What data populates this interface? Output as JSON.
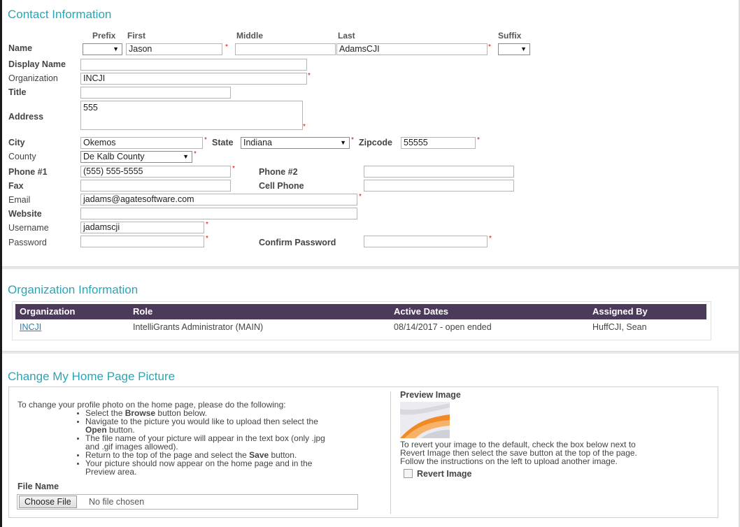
{
  "contact": {
    "title": "Contact Information",
    "col_headers": {
      "prefix": "Prefix",
      "first": "First",
      "middle": "Middle",
      "last": "Last",
      "suffix": "Suffix"
    },
    "labels": {
      "name": "Name",
      "display_name": "Display Name",
      "organization": "Organization",
      "title": "Title",
      "address": "Address",
      "city": "City",
      "state": "State",
      "zipcode": "Zipcode",
      "county": "County",
      "phone1": "Phone #1",
      "phone2": "Phone #2",
      "fax": "Fax",
      "cell": "Cell Phone",
      "email": "Email",
      "website": "Website",
      "username": "Username",
      "password": "Password",
      "confirm_password": "Confirm Password"
    },
    "values": {
      "prefix": "",
      "first": "Jason",
      "middle": "",
      "last": "AdamsCJI",
      "suffix": "",
      "display_name": "",
      "organization": "INCJI",
      "title": "",
      "address": "555",
      "city": "Okemos",
      "state": "Indiana",
      "zipcode": "55555",
      "county": "De Kalb County",
      "phone1": "(555) 555-5555",
      "phone2": "",
      "fax": "",
      "cell": "",
      "email": "jadams@agatesoftware.com",
      "website": "",
      "username": "jadamscji",
      "password": "",
      "confirm_password": ""
    },
    "required_mark": "*",
    "dropdown_glyph": "▼"
  },
  "org_info": {
    "title": "Organization Information",
    "columns": [
      "Organization",
      "Role",
      "Active Dates",
      "Assigned By"
    ],
    "rows": [
      {
        "organization": "INCJI",
        "role": "IntelliGrants Administrator (MAIN)",
        "dates": "08/14/2017 - open ended",
        "assigned_by": "HuffCJI, Sean"
      }
    ]
  },
  "picture": {
    "title": "Change My Home Page Picture",
    "intro": "To change your profile photo on the home page, please do the following:",
    "steps": {
      "s1_pre": "Select the ",
      "s1_bold": "Browse",
      "s1_post": " button below.",
      "s2_line1": "Navigate to the picture you would like to upload then select the",
      "s2_bold": "Open",
      "s2_post": " button.",
      "s3_line1": "The file name of your picture will appear in the text box (only .jpg",
      "s3_line2": "and .gif images allowed).",
      "s4_pre": "Return to the top of the page and select the ",
      "s4_bold": "Save",
      "s4_post": " button.",
      "s5_line1": "Your picture should now appear on the home page and in the",
      "s5_line2": "Preview area."
    },
    "file_name_label": "File Name",
    "choose_file_label": "Choose File",
    "no_file_text": "No file chosen",
    "preview_label": "Preview Image",
    "revert_text_1": "To revert your image to the default, check the box below next to",
    "revert_text_2": "Revert Image then select the save button at the top of the page.",
    "revert_text_3": "Follow the instructions on the left to upload another image.",
    "revert_label": "Revert Image",
    "revert_checked": false
  }
}
